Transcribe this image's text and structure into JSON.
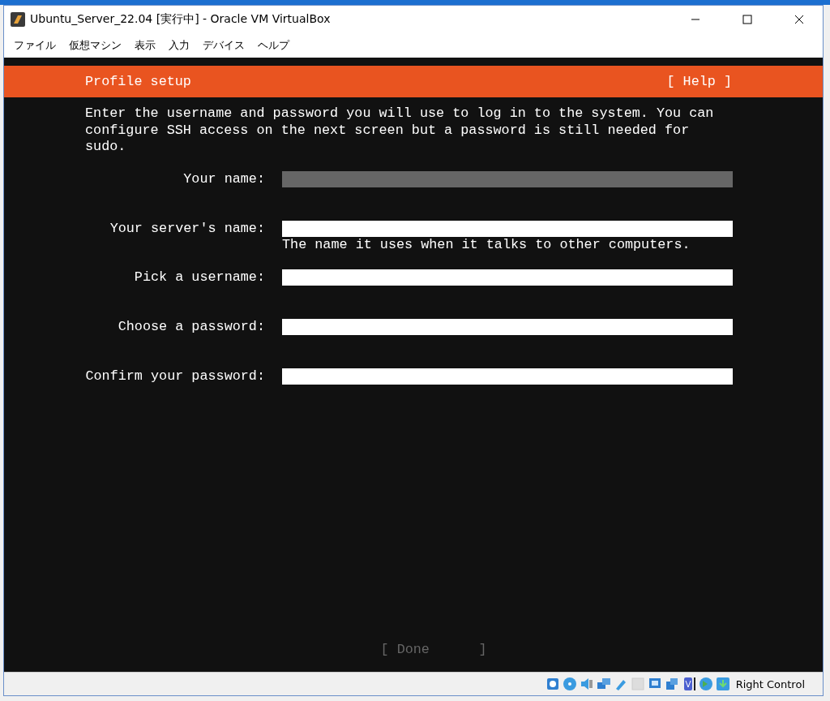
{
  "window": {
    "title": "Ubuntu_Server_22.04 [実行中] - Oracle VM VirtualBox"
  },
  "menu": [
    "ファイル",
    "仮想マシン",
    "表示",
    "入力",
    "デバイス",
    "ヘルプ"
  ],
  "installer": {
    "title": "Profile setup",
    "help": "[ Help ]",
    "intro": "Enter the username and password you will use to log in to the system. You can configure SSH access on the next screen but a password is still needed for sudo.",
    "fields": [
      {
        "label": "Your name:",
        "focused": true
      },
      {
        "label": "Your server's name:",
        "focused": false,
        "hint": "The name it uses when it talks to other computers."
      },
      {
        "label": "Pick a username:",
        "focused": false
      },
      {
        "label": "Choose a password:",
        "focused": false
      },
      {
        "label": "Confirm your password:",
        "focused": false
      }
    ],
    "done": {
      "open": "[ Done",
      "close": "]",
      "disabled": true
    }
  },
  "status_bar": {
    "host_key": "Right Control"
  }
}
